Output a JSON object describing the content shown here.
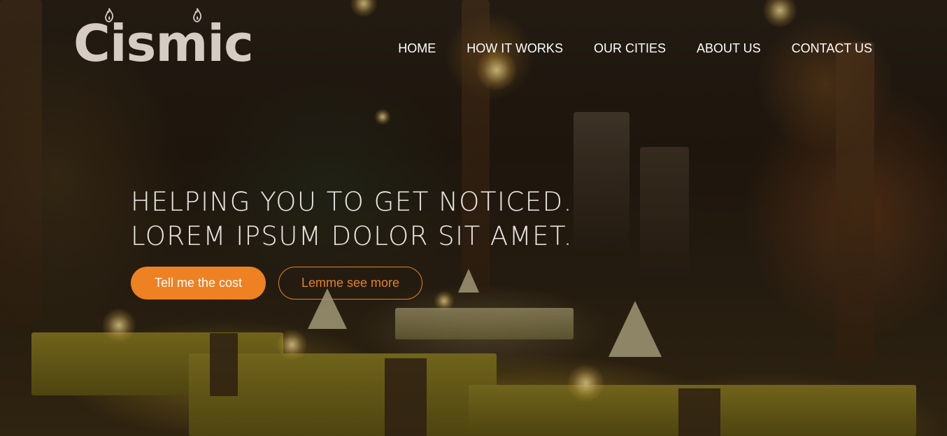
{
  "brand": {
    "name": "Cismic",
    "color": "#d6ccc4"
  },
  "nav": {
    "items": [
      {
        "label": "HOME"
      },
      {
        "label": "HOW IT WORKS"
      },
      {
        "label": "OUR CITIES"
      },
      {
        "label": "ABOUT US"
      },
      {
        "label": "CONTACT US"
      }
    ]
  },
  "hero": {
    "headline_line_1": "HELPING YOU TO GET NOTICED.",
    "headline_line_2": "LOREM IPSUM DOLOR SIT AMET.",
    "primary_button": "Tell me the cost",
    "secondary_button": "Lemme see more",
    "background_description_icon": "restaurant-background-image"
  },
  "colors": {
    "accent": "#ee8122",
    "text": "#ffffff"
  }
}
